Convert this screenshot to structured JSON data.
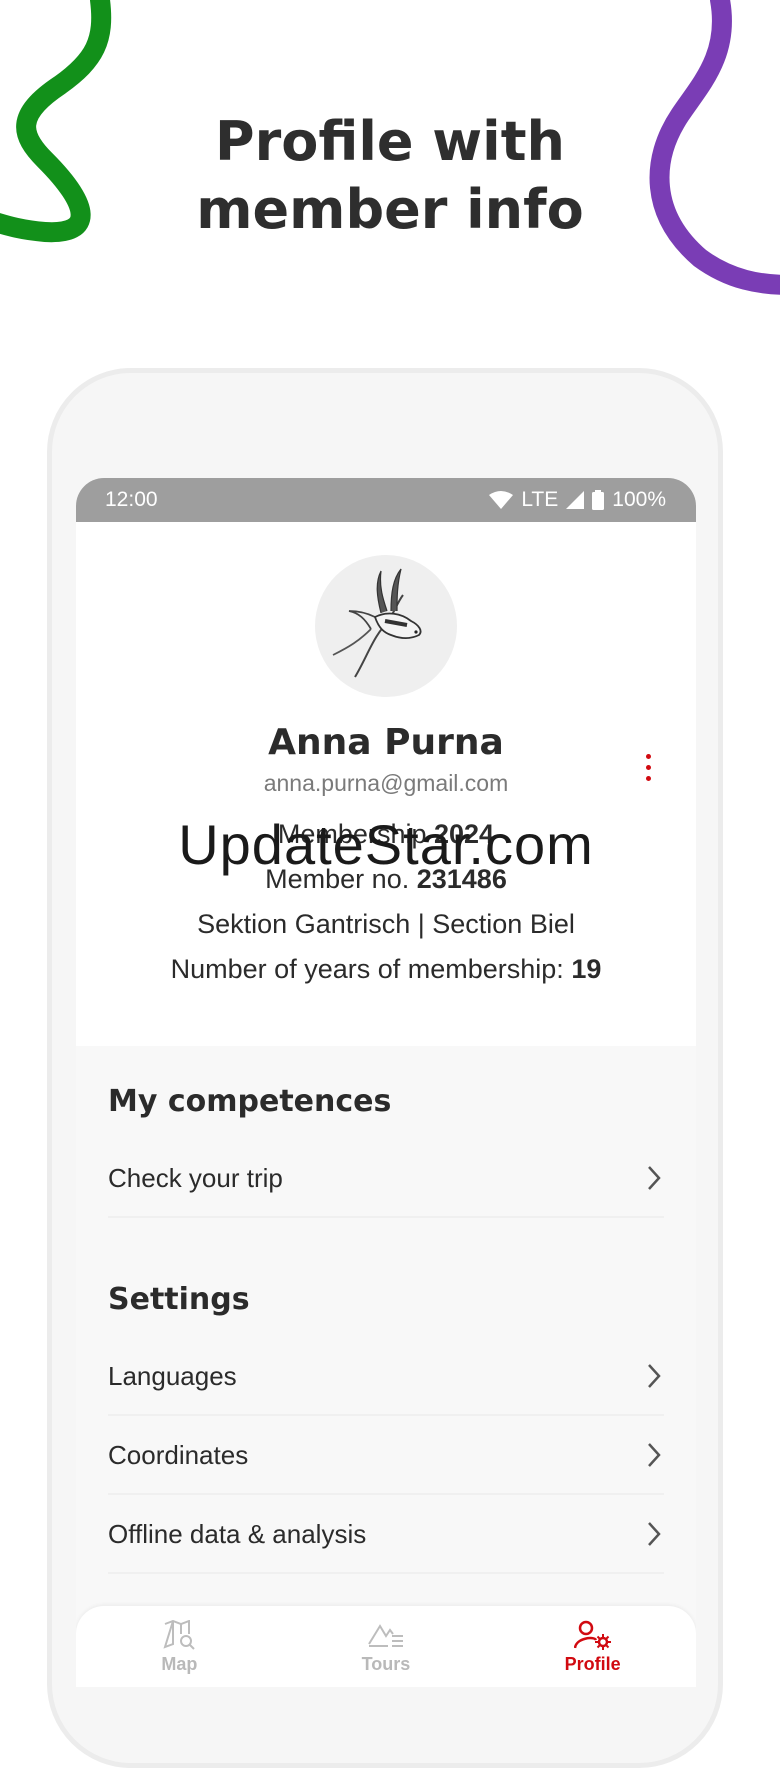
{
  "promo": {
    "title": "Profile with\nmember info"
  },
  "colors": {
    "accent": "#d10a11",
    "green_stroke": "#12901a",
    "purple_stroke": "#7a3db5",
    "status_bar": "#9e9e9e"
  },
  "status_bar": {
    "time": "12:00",
    "network": "LTE",
    "battery": "100%",
    "icons": [
      "wifi-icon",
      "signal-icon",
      "battery-icon"
    ]
  },
  "profile": {
    "avatar_icon": "chamois-icon",
    "name": "Anna Purna",
    "email": "anna.purna@gmail.com",
    "menu_icon": "more-vertical-icon",
    "membership_label": "Membership",
    "membership_year": "2024",
    "member_no_label": "Member no.",
    "member_no": "231486",
    "sections": "Sektion Gantrisch | Section Biel",
    "years_label": "Number of years of membership:",
    "years": "19"
  },
  "watermark": "UpdateStar.com",
  "competences": {
    "title": "My competences",
    "items": [
      {
        "label": "Check your trip"
      }
    ]
  },
  "settings": {
    "title": "Settings",
    "items": [
      {
        "label": "Languages"
      },
      {
        "label": "Coordinates"
      },
      {
        "label": "Offline data & analysis"
      }
    ]
  },
  "bottom_nav": {
    "items": [
      {
        "label": "Map",
        "icon": "map-search-icon",
        "active": false
      },
      {
        "label": "Tours",
        "icon": "mountain-list-icon",
        "active": false
      },
      {
        "label": "Profile",
        "icon": "user-settings-icon",
        "active": true
      }
    ]
  }
}
